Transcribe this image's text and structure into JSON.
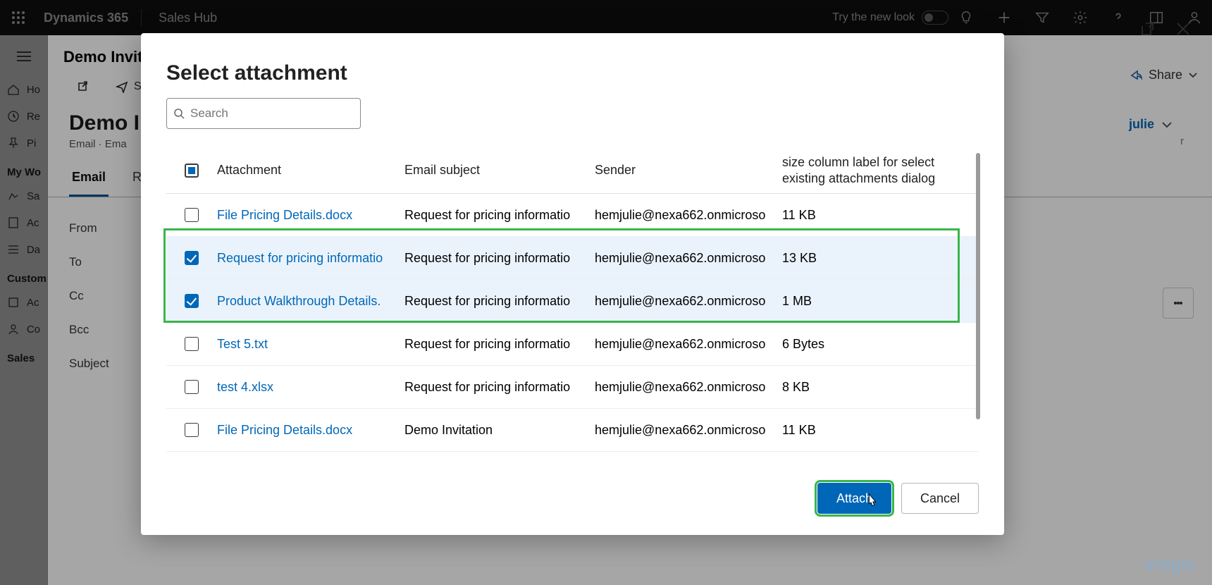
{
  "topbar": {
    "brand": "Dynamics 365",
    "app": "Sales Hub",
    "newlook": "Try the new look"
  },
  "sidebar": {
    "items": [
      "Ho",
      "Re",
      "Pi"
    ],
    "section1": "My Wo",
    "items2": [
      "Sa",
      "Ac",
      "Da"
    ],
    "section2": "Custom",
    "items3": [
      "Ac",
      "Co"
    ],
    "section3": "Sales"
  },
  "record": {
    "tab_title": "Demo Invitat",
    "title": "Demo Inv",
    "subtitle": "Email  ·  Ema",
    "cmd_send": "Sen",
    "tabs": {
      "email": "Email",
      "related": "Rel"
    },
    "form": {
      "from": "From",
      "to": "To",
      "cc": "Cc",
      "bcc": "Bcc",
      "subject": "Subject"
    },
    "owner_label": "r",
    "owner_name": "julie",
    "share": "Share"
  },
  "dialog": {
    "title": "Select attachment",
    "search_placeholder": "Search",
    "columns": {
      "attachment": "Attachment",
      "subject": "Email subject",
      "sender": "Sender",
      "size": "size column label for select existing attachments dialog"
    },
    "rows": [
      {
        "selected": false,
        "name": "File Pricing Details.docx",
        "subject": "Request for pricing informatio",
        "sender": "hemjulie@nexa662.onmicroso",
        "size": "11 KB"
      },
      {
        "selected": true,
        "name": "Request for pricing informatio",
        "subject": "Request for pricing informatio",
        "sender": "hemjulie@nexa662.onmicroso",
        "size": "13 KB"
      },
      {
        "selected": true,
        "name": "Product Walkthrough Details.",
        "subject": "Request for pricing informatio",
        "sender": "hemjulie@nexa662.onmicroso",
        "size": "1 MB"
      },
      {
        "selected": false,
        "name": "Test 5.txt",
        "subject": "Request for pricing informatio",
        "sender": "hemjulie@nexa662.onmicroso",
        "size": "6 Bytes"
      },
      {
        "selected": false,
        "name": "test 4.xlsx",
        "subject": "Request for pricing informatio",
        "sender": "hemjulie@nexa662.onmicroso",
        "size": "8 KB"
      },
      {
        "selected": false,
        "name": "File Pricing Details.docx",
        "subject": "Demo Invitation",
        "sender": "hemjulie@nexa662.onmicroso",
        "size": "11 KB"
      }
    ],
    "buttons": {
      "attach": "Attach",
      "cancel": "Cancel"
    }
  },
  "watermark": "inogic"
}
